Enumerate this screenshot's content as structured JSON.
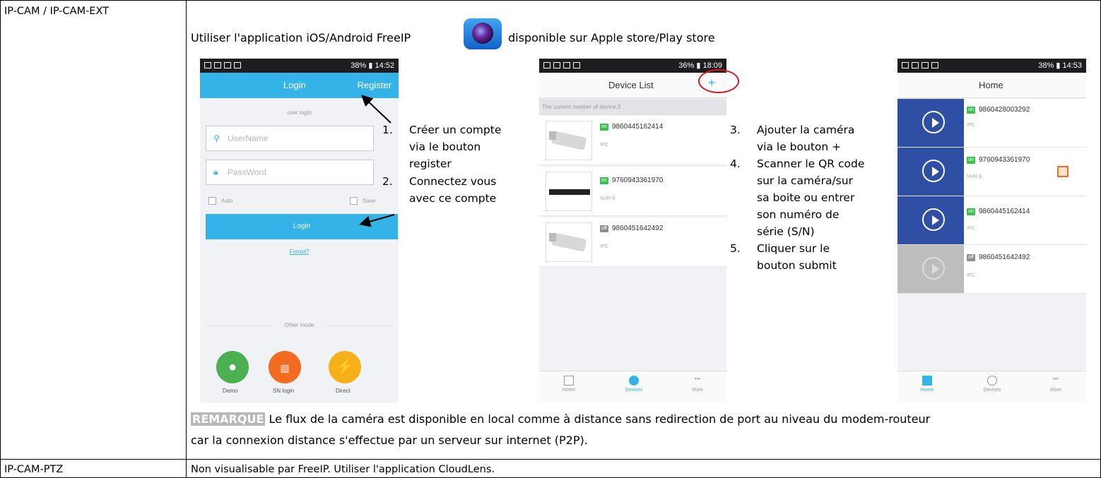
{
  "rows": [
    {
      "label": "IP-CAM / IP-CAM-EXT"
    },
    {
      "label": "IP-CAM-PTZ",
      "text": "Non visualisable par FreeIP. Utiliser l'application CloudLens."
    }
  ],
  "intro": {
    "before": "Utiliser l'application iOS/Android FreeIP",
    "after": "disponible sur Apple store/Play store"
  },
  "login_screen": {
    "time": "14:52",
    "battery": "38%",
    "title": "Login",
    "register": "Register",
    "user_login": "user login",
    "username_placeholder": "UserName",
    "password_placeholder": "PassWord",
    "auto": "Auto",
    "save": "Save",
    "login_button": "Login",
    "forgot": "Forgot?",
    "other_mode": "Other mode",
    "modes": [
      "Demo",
      "SN login",
      "Direct"
    ]
  },
  "steps_left": [
    {
      "n": "1.",
      "lines": [
        "Créer un compte",
        "via le bouton",
        "register"
      ]
    },
    {
      "n": "2.",
      "lines": [
        "Connectez vous",
        "avec ce compte"
      ]
    }
  ],
  "device_screen": {
    "time": "18:09",
    "battery": "36%",
    "title": "Device List",
    "add": "+",
    "count_text": "The current number of device:3",
    "devices": [
      {
        "status": "on",
        "number": "9860445162414",
        "type": "IPC"
      },
      {
        "status": "on",
        "number": "9760943361970",
        "type": "NVR-9"
      },
      {
        "status": "off",
        "number": "9860451642492",
        "type": "IPC"
      }
    ],
    "tabs": [
      "Home",
      "Devices",
      "More"
    ]
  },
  "steps_right": [
    {
      "n": "3.",
      "lines": [
        "Ajouter la caméra",
        "via le bouton +"
      ]
    },
    {
      "n": "4.",
      "lines": [
        "Scanner le QR code",
        "sur la caméra/sur",
        "sa boite ou entrer",
        "son numéro de",
        "série (S/N)"
      ]
    },
    {
      "n": "5.",
      "lines": [
        "Cliquer sur le",
        "bouton submit"
      ]
    }
  ],
  "home_screen": {
    "time": "14:53",
    "battery": "38%",
    "title": "Home",
    "items": [
      {
        "status": "on",
        "number": "9860428003292",
        "type": "IPC"
      },
      {
        "status": "on",
        "number": "9760943361970",
        "type": "NVR-9"
      },
      {
        "status": "on",
        "number": "9860445162414",
        "type": "IPC"
      },
      {
        "status": "off",
        "number": "9860451642492",
        "type": "IPC"
      }
    ],
    "tabs": [
      "Home",
      "Devices",
      "More"
    ]
  },
  "remark": {
    "tag": "REMARQUE",
    "line1": "Le flux de la caméra est disponible en local comme à distance sans redirection de port au niveau du modem-routeur",
    "line2": "car la connexion distance s'effectue par un serveur sur internet (P2P)."
  },
  "colors": {
    "blue_header": "#33b3e7",
    "tile_blue": "#2f4fa4",
    "on_green": "#3bbf4f",
    "demo_green": "#4caf50",
    "sn_orange": "#f26b21",
    "direct_yellow": "#f6b11a",
    "highlight_red": "#e0161c"
  }
}
